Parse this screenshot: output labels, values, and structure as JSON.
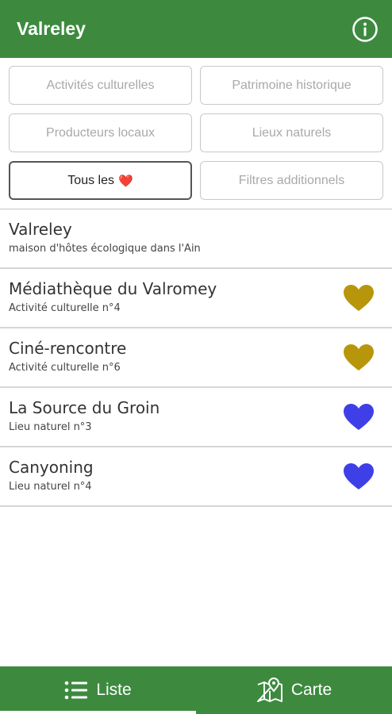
{
  "header": {
    "title": "Valreley",
    "info_icon": "info-circle-icon"
  },
  "filters": {
    "cultural": "Activités culturelles",
    "heritage": "Patrimoine historique",
    "producers": "Producteurs locaux",
    "natural": "Lieux naturels",
    "favorites": "Tous les",
    "favorites_emoji": "❤️",
    "additional": "Filtres additionnels"
  },
  "list": {
    "items": [
      {
        "name": "Valreley",
        "subtitle": "maison d'hôtes écologique dans l'Ain",
        "heart_color": ""
      },
      {
        "name": "Médiathèque du Valromey",
        "subtitle": "Activité culturelle n°4",
        "heart_color": "#b8960b"
      },
      {
        "name": "Ciné-rencontre",
        "subtitle": "Activité culturelle n°6",
        "heart_color": "#b8960b"
      },
      {
        "name": "La Source du Groin",
        "subtitle": "Lieu naturel n°3",
        "heart_color": "#3f3fe8"
      },
      {
        "name": "Canyoning",
        "subtitle": "Lieu naturel n°4",
        "heart_color": "#3f3fe8"
      }
    ]
  },
  "nav": {
    "list_label": "Liste",
    "list_icon": "list-icon",
    "map_label": "Carte",
    "map_icon": "map-pin-icon"
  },
  "colors": {
    "primary": "#3d8a3f",
    "gold_heart": "#b8960b",
    "blue_heart": "#3f3fe8"
  }
}
